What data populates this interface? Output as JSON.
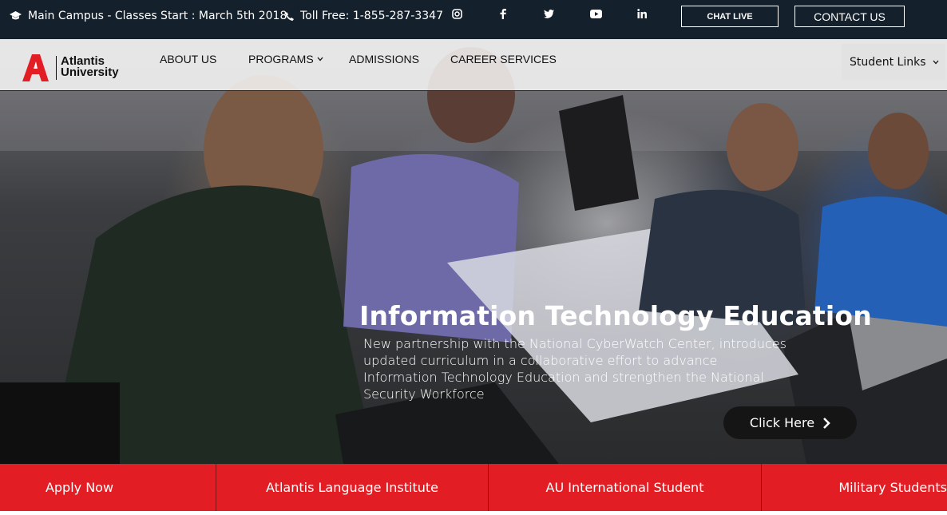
{
  "topbar": {
    "campus_text": "Main Campus - Classes Start : March 5th 2018",
    "phone_text": "Toll Free: 1-855-287-3347",
    "social": [
      "instagram-icon",
      "facebook-icon",
      "twitter-icon",
      "youtube-icon",
      "linkedin-icon"
    ],
    "chat_label": "CHAT LIVE",
    "contact_label": "CONTACT US"
  },
  "logo": {
    "line1": "Atlantis",
    "line2": "University"
  },
  "nav": {
    "items": [
      "ABOUT US",
      "PROGRAMS",
      "ADMISSIONS",
      "CAREER SERVICES"
    ],
    "student_links": "Student Links"
  },
  "hero": {
    "title": "Information Technology Education",
    "text": "New partnership with the National CyberWatch Center, introduces updated curriculum in a collaborative effort to advance Information Technology Education and strengthen the National Security Workforce",
    "button": "Click Here"
  },
  "quicklinks": [
    "Apply Now",
    "Atlantis Language Institute",
    "AU International Student",
    "Military Students"
  ],
  "colors": {
    "topbar": "#14202c",
    "brand_red": "#e31d24",
    "button_dark": "#151515"
  }
}
